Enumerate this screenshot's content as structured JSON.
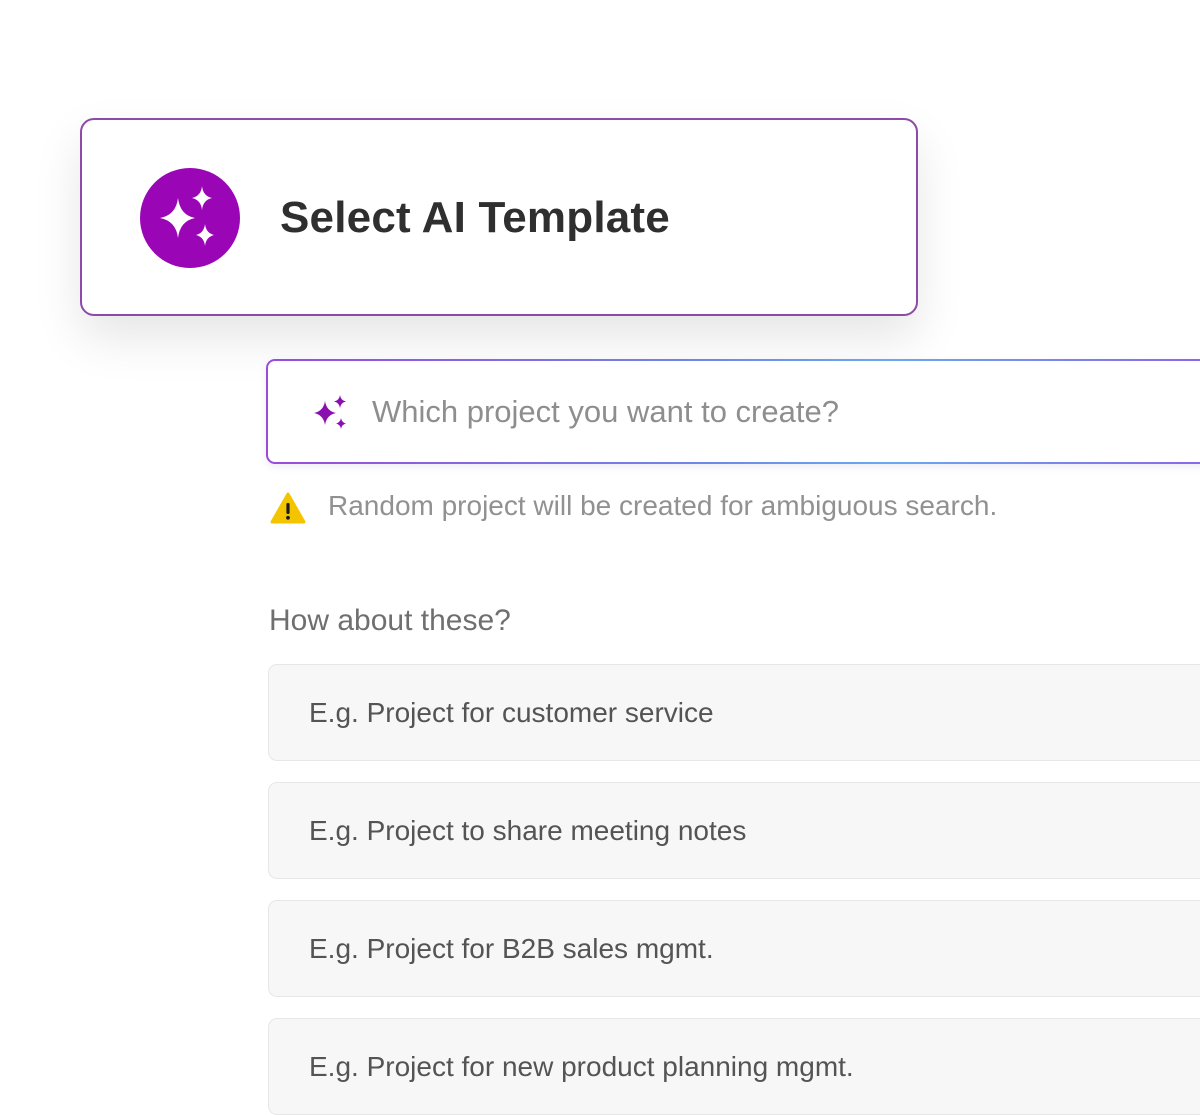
{
  "header": {
    "title": "Select AI Template",
    "icon": "sparkles-icon",
    "icon_bg_color": "#9a06b6"
  },
  "search": {
    "placeholder": "Which project you want to create?",
    "value": "",
    "icon": "sparkles-icon",
    "icon_color": "#8a10b0"
  },
  "warning": {
    "icon": "warning-icon",
    "icon_color": "#f5c400",
    "text": "Random project will be created for ambiguous search."
  },
  "suggestions": {
    "heading": "How about these?",
    "items": [
      {
        "label": "E.g. Project for customer service"
      },
      {
        "label": "E.g. Project to share meeting notes"
      },
      {
        "label": "E.g. Project for B2B sales mgmt."
      },
      {
        "label": "E.g. Project for new product planning mgmt."
      }
    ]
  }
}
